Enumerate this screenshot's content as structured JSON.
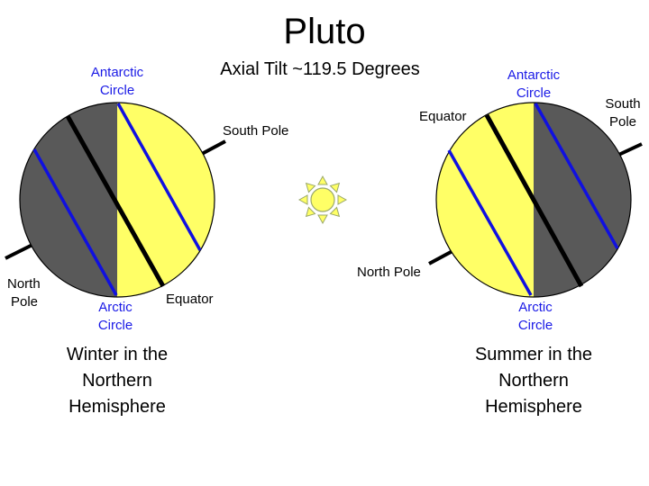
{
  "title": "Pluto",
  "subtitle": "Axial Tilt ~119.5 Degrees",
  "colors": {
    "day": "#ffff66",
    "night": "#595959",
    "axis": "#000000",
    "circle_line": "#1010e0",
    "label_blue": "#1a1ae6"
  },
  "sun_icon": "sun-icon",
  "left": {
    "antarctic": [
      "Antarctic",
      "Circle"
    ],
    "south_pole": "South Pole",
    "north_pole": [
      "North",
      "Pole"
    ],
    "arctic": [
      "Arctic",
      "Circle"
    ],
    "equator": "Equator",
    "caption": [
      "Winter in the",
      "Northern",
      "Hemisphere"
    ]
  },
  "right": {
    "antarctic": [
      "Antarctic",
      "Circle"
    ],
    "equator": "Equator",
    "south_pole": [
      "South",
      "Pole"
    ],
    "north_pole": "North Pole",
    "arctic": [
      "Arctic",
      "Circle"
    ],
    "caption": [
      "Summer in the",
      "Northern",
      "Hemisphere"
    ]
  }
}
